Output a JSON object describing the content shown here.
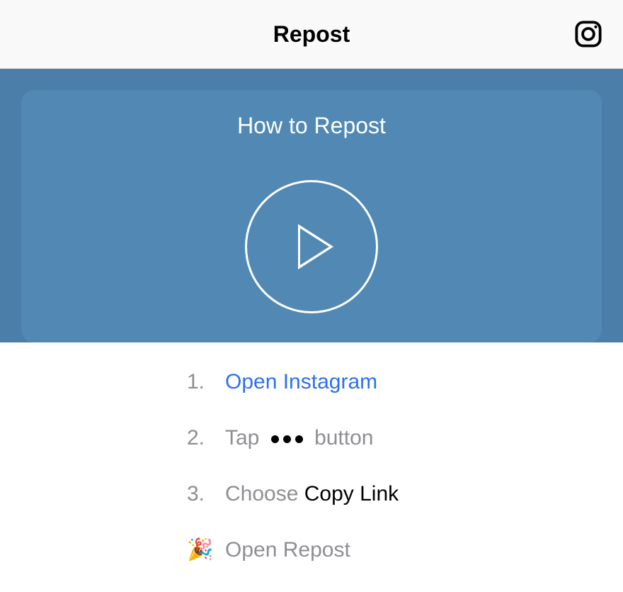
{
  "header": {
    "title": "Repost"
  },
  "hero": {
    "title": "How to Repost"
  },
  "steps": {
    "items": [
      {
        "number": "1.",
        "link_text": "Open Instagram"
      },
      {
        "number": "2.",
        "text_before": "Tap",
        "text_after": "button"
      },
      {
        "number": "3.",
        "text_gray": "Choose ",
        "text_black": "Copy Link"
      }
    ],
    "final": {
      "emoji": "🎉",
      "text": "Open Repost"
    }
  }
}
